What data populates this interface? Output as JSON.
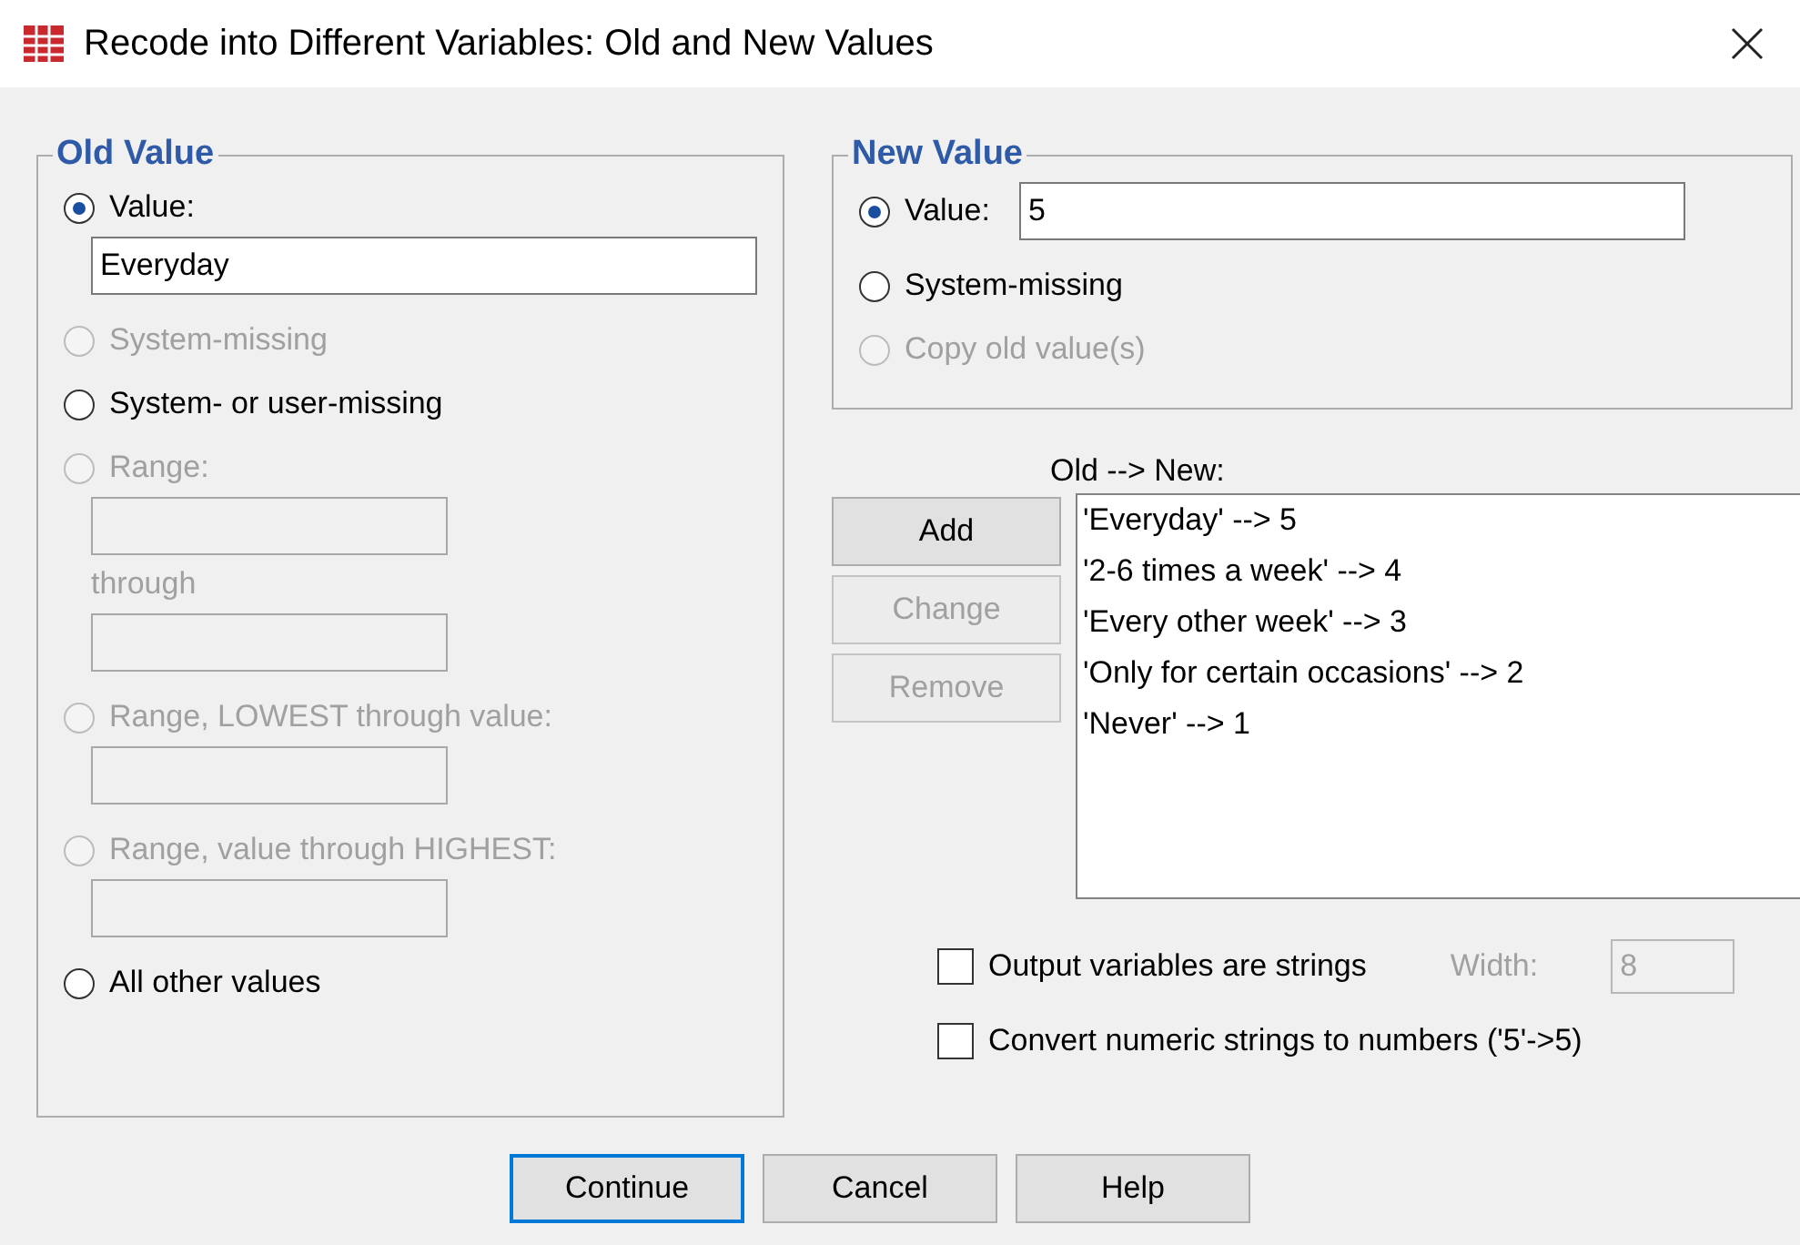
{
  "window": {
    "title": "Recode into Different Variables: Old and New Values"
  },
  "old_value": {
    "title": "Old Value",
    "options": [
      {
        "kind": "value",
        "label": "Value:",
        "selected": true,
        "disabled": false,
        "value": "Everyday"
      },
      {
        "kind": "plain",
        "label": "System-missing",
        "selected": false,
        "disabled": true
      },
      {
        "kind": "plain",
        "label": "System- or user-missing",
        "selected": false,
        "disabled": false
      },
      {
        "kind": "range",
        "label": "Range:",
        "selected": false,
        "disabled": true,
        "through_label": "through"
      },
      {
        "kind": "field",
        "label": "Range, LOWEST through value:",
        "selected": false,
        "disabled": true
      },
      {
        "kind": "field",
        "label": "Range, value through HIGHEST:",
        "selected": false,
        "disabled": true
      },
      {
        "kind": "plain",
        "label": "All other values",
        "selected": false,
        "disabled": false
      }
    ]
  },
  "new_value": {
    "title": "New Value",
    "options": [
      {
        "kind": "value",
        "label": "Value:",
        "selected": true,
        "disabled": false,
        "value": "5"
      },
      {
        "kind": "plain",
        "label": "System-missing",
        "selected": false,
        "disabled": false
      },
      {
        "kind": "plain",
        "label": "Copy old value(s)",
        "selected": false,
        "disabled": true
      }
    ]
  },
  "mapping": {
    "label": "Old --> New:",
    "items": [
      "'Everyday' --> 5",
      "'2-6 times a week' --> 4",
      "'Every other week' --> 3",
      "'Only for certain occasions' --> 2",
      "'Never' --> 1"
    ]
  },
  "list_buttons": [
    {
      "label": "Add",
      "disabled": false
    },
    {
      "label": "Change",
      "disabled": true
    },
    {
      "label": "Remove",
      "disabled": true
    }
  ],
  "checkboxes": [
    {
      "label": "Output variables are strings",
      "checked": false
    },
    {
      "label": "Convert numeric strings to numbers ('5'->5)",
      "checked": false
    }
  ],
  "width": {
    "label": "Width:",
    "value": "8",
    "disabled": true
  },
  "buttons": [
    {
      "label": "Continue",
      "default": true
    },
    {
      "label": "Cancel",
      "default": false
    },
    {
      "label": "Help",
      "default": false
    }
  ]
}
